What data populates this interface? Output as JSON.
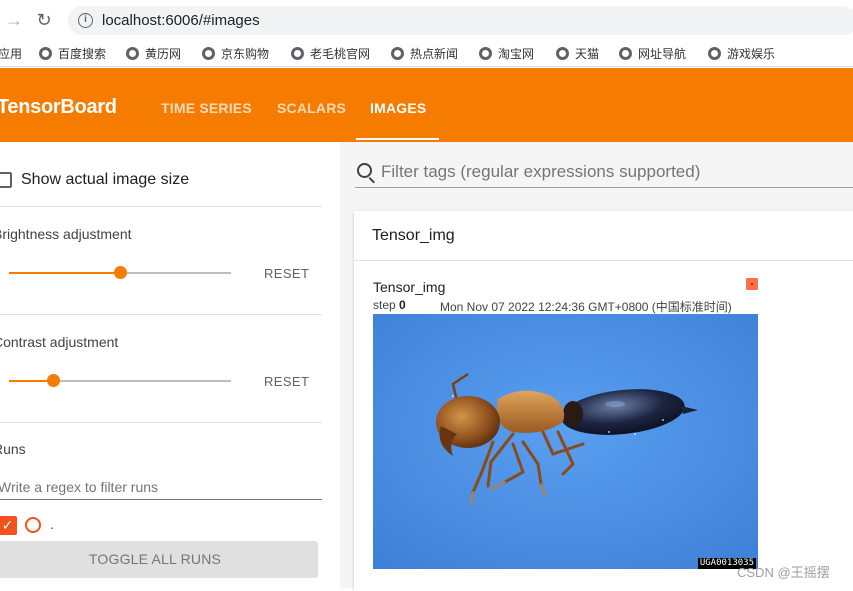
{
  "browser": {
    "url": "localhost:6006/#images",
    "bookmarks": [
      "应用",
      "百度搜索",
      "黄历网",
      "京东购物",
      "老毛桃官网",
      "热点新闻",
      "淘宝网",
      "天猫",
      "网址导航",
      "游戏娱乐"
    ]
  },
  "header": {
    "brand": "TensorBoard",
    "tabs": [
      {
        "label": "TIME SERIES",
        "active": false
      },
      {
        "label": "SCALARS",
        "active": false
      },
      {
        "label": "IMAGES",
        "active": true
      }
    ]
  },
  "sidebar": {
    "show_actual_size_label": "Show actual image size",
    "brightness": {
      "label": "Brightness adjustment",
      "value": 0.5,
      "reset_label": "RESET"
    },
    "contrast": {
      "label": "Contrast adjustment",
      "value": 0.2,
      "reset_label": "RESET"
    },
    "runs": {
      "label": "Runs",
      "filter_placeholder": "Write a regex to filter runs",
      "items": [
        {
          "name": ".",
          "checked": true,
          "color": "#f4511e"
        }
      ],
      "toggle_label": "TOGGLE ALL RUNS"
    }
  },
  "main": {
    "filter_placeholder": "Filter tags (regular expressions supported)",
    "group": {
      "title": "Tensor_img",
      "card": {
        "title": "Tensor_img",
        "step_label": "step",
        "step_value": "0",
        "wall_time": "Mon Nov 07 2022 12:24:36 GMT+0800 (中国标准时间)",
        "image_stamp": "UGA0013035"
      }
    }
  },
  "watermark": "CSDN @王摇摆",
  "colors": {
    "accent": "#f57c00",
    "run": "#f4511e"
  }
}
